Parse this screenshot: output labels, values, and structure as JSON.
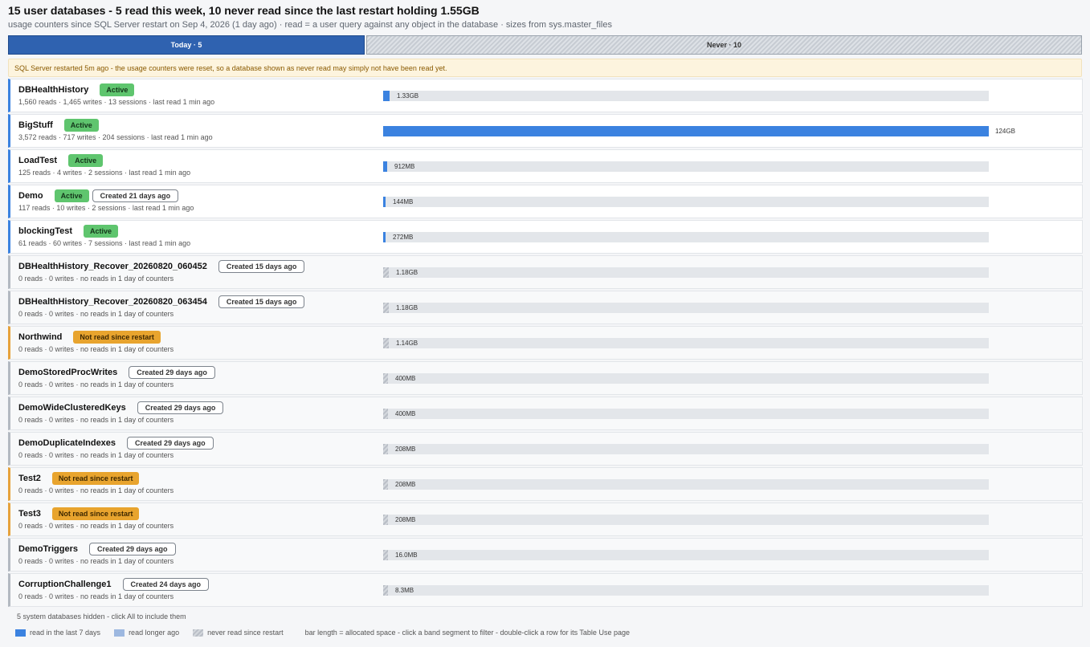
{
  "header": {
    "title": "15 user databases - 5 read this week, 10 never read since the last restart holding 1.55GB",
    "subtitle": "usage counters since SQL Server restart on Sep 4, 2026 (1 day ago)   ·   read = a user query against any object in the database   ·   sizes from sys.master_files"
  },
  "band": {
    "today_label": "Today · 5",
    "never_label": "Never · 10"
  },
  "notice": "SQL Server restarted 5m ago - the usage counters were reset, so a database shown as never read may simply not have been read yet.",
  "colors": {
    "recent": "#3b82e0",
    "today_band": "#2f62b0",
    "warning": "#e8a42e",
    "active": "#5fc56e"
  },
  "rows": [
    {
      "name": "DBHealthHistory",
      "badges": [
        {
          "kind": "active",
          "text": "Active"
        }
      ],
      "stats": "1,560 reads  ·  1,465 writes  ·  13 sessions  ·  last read 1 min ago",
      "size": "1.33GB",
      "fraction": 0.0107,
      "state": "recent"
    },
    {
      "name": "BigStuff",
      "badges": [
        {
          "kind": "active",
          "text": "Active"
        }
      ],
      "stats": "3,572 reads  ·  717 writes  ·  204 sessions  ·  last read 1 min ago",
      "size": "124GB",
      "fraction": 1.0,
      "state": "recent"
    },
    {
      "name": "LoadTest",
      "badges": [
        {
          "kind": "active",
          "text": "Active"
        }
      ],
      "stats": "125 reads  ·  4 writes  ·  2 sessions  ·  last read 1 min ago",
      "size": "912MB",
      "fraction": 0.0072,
      "state": "recent"
    },
    {
      "name": "Demo",
      "badges": [
        {
          "kind": "active",
          "text": "Active"
        },
        {
          "kind": "created",
          "text": "Created 21 days ago"
        }
      ],
      "stats": "117 reads  ·  10 writes  ·  2 sessions  ·  last read 1 min ago",
      "size": "144MB",
      "fraction": 0.0011,
      "state": "recent"
    },
    {
      "name": "blockingTest",
      "badges": [
        {
          "kind": "active",
          "text": "Active"
        }
      ],
      "stats": "61 reads  ·  60 writes  ·  7 sessions  ·  last read 1 min ago",
      "size": "272MB",
      "fraction": 0.0021,
      "state": "recent"
    },
    {
      "name": "DBHealthHistory_Recover_20260820_060452",
      "badges": [
        {
          "kind": "created",
          "text": "Created 15 days ago"
        }
      ],
      "stats": "0 reads  ·  0 writes  ·  no reads in 1 day of counters",
      "size": "1.18GB",
      "fraction": 0.0095,
      "state": "never"
    },
    {
      "name": "DBHealthHistory_Recover_20260820_063454",
      "badges": [
        {
          "kind": "created",
          "text": "Created 15 days ago"
        }
      ],
      "stats": "0 reads  ·  0 writes  ·  no reads in 1 day of counters",
      "size": "1.18GB",
      "fraction": 0.0095,
      "state": "never"
    },
    {
      "name": "Northwind",
      "badges": [
        {
          "kind": "warn",
          "text": "Not read since restart"
        }
      ],
      "stats": "0 reads  ·  0 writes  ·  no reads in 1 day of counters",
      "size": "1.14GB",
      "fraction": 0.0092,
      "state": "warn"
    },
    {
      "name": "DemoStoredProcWrites",
      "badges": [
        {
          "kind": "created",
          "text": "Created 29 days ago"
        }
      ],
      "stats": "0 reads  ·  0 writes  ·  no reads in 1 day of counters",
      "size": "400MB",
      "fraction": 0.0031,
      "state": "never"
    },
    {
      "name": "DemoWideClusteredKeys",
      "badges": [
        {
          "kind": "created",
          "text": "Created 29 days ago"
        }
      ],
      "stats": "0 reads  ·  0 writes  ·  no reads in 1 day of counters",
      "size": "400MB",
      "fraction": 0.0031,
      "state": "never"
    },
    {
      "name": "DemoDuplicateIndexes",
      "badges": [
        {
          "kind": "created",
          "text": "Created 29 days ago"
        }
      ],
      "stats": "0 reads  ·  0 writes  ·  no reads in 1 day of counters",
      "size": "208MB",
      "fraction": 0.0016,
      "state": "never"
    },
    {
      "name": "Test2",
      "badges": [
        {
          "kind": "warn",
          "text": "Not read since restart"
        }
      ],
      "stats": "0 reads  ·  0 writes  ·  no reads in 1 day of counters",
      "size": "208MB",
      "fraction": 0.0016,
      "state": "warn"
    },
    {
      "name": "Test3",
      "badges": [
        {
          "kind": "warn",
          "text": "Not read since restart"
        }
      ],
      "stats": "0 reads  ·  0 writes  ·  no reads in 1 day of counters",
      "size": "208MB",
      "fraction": 0.0016,
      "state": "warn"
    },
    {
      "name": "DemoTriggers",
      "badges": [
        {
          "kind": "created",
          "text": "Created 29 days ago"
        }
      ],
      "stats": "0 reads  ·  0 writes  ·  no reads in 1 day of counters",
      "size": "16.0MB",
      "fraction": 0.0001,
      "state": "never"
    },
    {
      "name": "CorruptionChallenge1",
      "badges": [
        {
          "kind": "created",
          "text": "Created 24 days ago"
        }
      ],
      "stats": "0 reads  ·  0 writes  ·  no reads in 1 day of counters",
      "size": "8.3MB",
      "fraction": 0.0001,
      "state": "never"
    }
  ],
  "footer": {
    "hidden_note": "5 system databases hidden - click All to include them",
    "legend": {
      "recent": "read in the last 7 days",
      "longer": "read longer ago",
      "never": "never read since restart",
      "hint": "bar length = allocated space - click a band segment to filter - double-click a row for its Table Use page"
    }
  }
}
